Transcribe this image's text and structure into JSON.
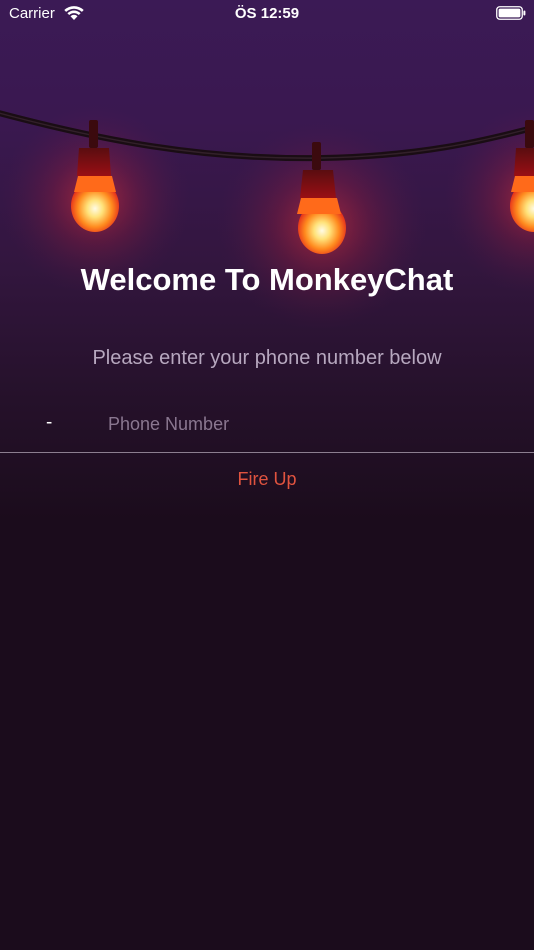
{
  "status_bar": {
    "carrier": "Carrier",
    "time": "ÖS 12:59"
  },
  "welcome": {
    "title": "Welcome To MonkeyChat",
    "subtitle": "Please enter your phone number below"
  },
  "phone": {
    "country_code": "-",
    "placeholder": "Phone Number",
    "value": ""
  },
  "actions": {
    "fire_up_label": "Fire Up"
  },
  "colors": {
    "background_top": "#3b1a55",
    "background_bottom": "#1b0c1c",
    "accent": "#e0533f",
    "subtitle": "#b7a8bf",
    "placeholder": "#8a7790"
  },
  "icons": {
    "wifi": "wifi-icon",
    "battery": "battery-icon",
    "bulb": "light-bulb-icon"
  }
}
